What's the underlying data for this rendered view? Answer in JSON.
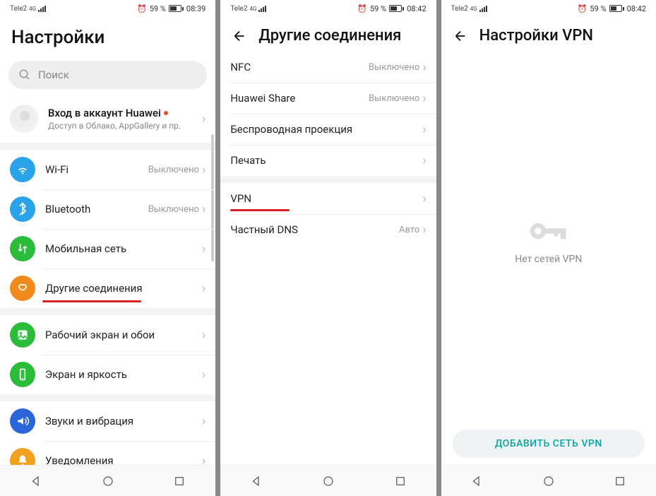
{
  "screens": {
    "s1": {
      "status": {
        "carrier": "Tele2",
        "net": "4G",
        "battery": "59 %",
        "time": "08:39"
      },
      "title": "Настройки",
      "search_placeholder": "Поиск",
      "account": {
        "title": "Вход в аккаунт Huawei",
        "sub": "Доступ в Облако, AppGallery и пр."
      },
      "rows": {
        "wifi": {
          "label": "Wi-Fi",
          "value": "Выключено"
        },
        "bt": {
          "label": "Bluetooth",
          "value": "Выключено"
        },
        "mobile": {
          "label": "Мобильная сеть",
          "value": ""
        },
        "other": {
          "label": "Другие соединения",
          "value": ""
        },
        "home": {
          "label": "Рабочий экран и обои",
          "value": ""
        },
        "disp": {
          "label": "Экран и яркость",
          "value": ""
        },
        "sound": {
          "label": "Звуки и вибрация",
          "value": ""
        },
        "notif": {
          "label": "Уведомления",
          "value": ""
        }
      }
    },
    "s2": {
      "status": {
        "carrier": "Tele2",
        "net": "4G",
        "battery": "59 %",
        "time": "08:42"
      },
      "title": "Другие соединения",
      "rows": {
        "nfc": {
          "label": "NFC",
          "value": "Выключено"
        },
        "share": {
          "label": "Huawei Share",
          "value": "Выключено"
        },
        "proj": {
          "label": "Беспроводная проекция",
          "value": ""
        },
        "print": {
          "label": "Печать",
          "value": ""
        },
        "vpn": {
          "label": "VPN",
          "value": ""
        },
        "dns": {
          "label": "Частный DNS",
          "value": "Авто"
        }
      }
    },
    "s3": {
      "status": {
        "carrier": "Tele2",
        "net": "4G",
        "battery": "59 %",
        "time": "08:42"
      },
      "title": "Настройки VPN",
      "empty": "Нет сетей VPN",
      "add_btn": "ДОБАВИТЬ СЕТЬ VPN"
    }
  }
}
